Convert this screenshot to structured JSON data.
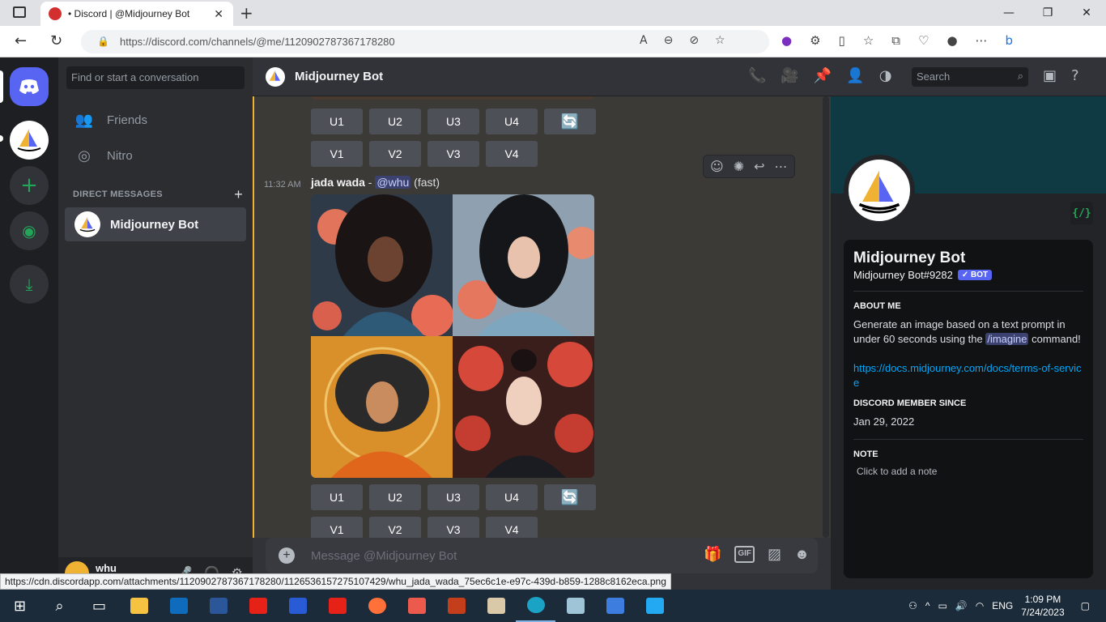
{
  "browser": {
    "tab_title": "• Discord | @Midjourney Bot",
    "url": "https://discord.com/channels/@me/1120902787367178280"
  },
  "sidebar": {
    "search_placeholder": "Find or start a conversation",
    "friends": "Friends",
    "nitro": "Nitro",
    "dm_header": "DIRECT MESSAGES",
    "dm_items": [
      {
        "label": "Midjourney Bot"
      }
    ],
    "user": {
      "name": "whu"
    }
  },
  "channel": {
    "title": "Midjourney Bot",
    "search_placeholder": "Search"
  },
  "message_top": {
    "upscale": [
      "U1",
      "U2",
      "U3",
      "U4"
    ],
    "variation": [
      "V1",
      "V2",
      "V3",
      "V4"
    ]
  },
  "message": {
    "time": "11:32 AM",
    "author": "jada wada",
    "sep": " - ",
    "mention": "@whu",
    "mode": " (fast)",
    "upscale": [
      "U1",
      "U2",
      "U3",
      "U4"
    ],
    "variation": [
      "V1",
      "V2",
      "V3",
      "V4"
    ]
  },
  "composer": {
    "placeholder": "Message @Midjourney Bot",
    "gif": "GIF"
  },
  "profile": {
    "name": "Midjourney Bot",
    "tag": "Midjourney Bot#9282",
    "bot_badge": "✓ BOT",
    "dev_badge": "{/}",
    "about_heading": "ABOUT ME",
    "about_pre": "Generate an image based on a text prompt in under 60 seconds using the ",
    "about_cmd": "/imagine",
    "about_post": " command!",
    "link": "https://docs.midjourney.com/docs/terms-of-service",
    "member_heading": "DISCORD MEMBER SINCE",
    "member_since": "Jan 29, 2022",
    "note_heading": "NOTE",
    "note_placeholder": "Click to add a note"
  },
  "status_url": "https://cdn.discordapp.com/attachments/1120902787367178280/1126536157275107429/whu_jada_wada_75ec6c1e-e97c-439d-b859-1288c8162eca.png",
  "taskbar": {
    "lang": "ENG",
    "time": "1:09 PM",
    "date": "7/24/2023"
  },
  "colors": {
    "accent": "#5865f2",
    "highlight": "#f0b232",
    "link": "#00a8fc"
  }
}
